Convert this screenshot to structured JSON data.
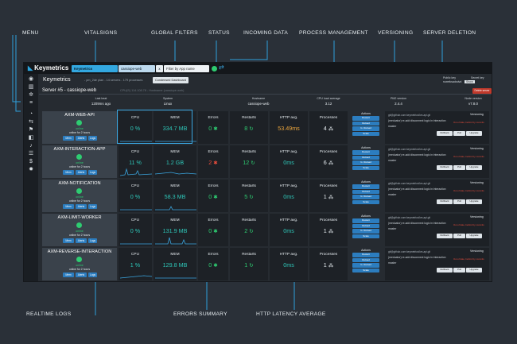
{
  "callouts": {
    "menu": "MENU",
    "vitalsigns": "VITALSIGNS",
    "global_filters": "GLOBAL FILTERS",
    "status": "STATUS",
    "incoming_data": "INCOMING DATA",
    "process_management": "PROCESS MANAGEMENT",
    "versioning": "VERSIONING",
    "server_deletion": "SERVER DELETION",
    "realtime_logs": "REALTIME LOGS",
    "errors_summary": "ERRORS SUMMARY",
    "http_latency": "HTTP LATENCY AVERAGE"
  },
  "topbar": {
    "logo": "Keymetrics",
    "filter_app": "Keymetrics",
    "filter_server": "cassiope-web",
    "filter_clear": "x",
    "filter_placeholder": "Filter by App name"
  },
  "header": {
    "project": "Keymetrics",
    "subtitle": "- pm_2de plan - 14 servers - 179 processes",
    "dashboard_button": "Condensed Dashboard",
    "public_key_label": "Public key",
    "public_key_value": "rowefcsadsdvd",
    "secret_key_label": "Secret key",
    "secret_key_button": "Show"
  },
  "server": {
    "title": "Server #5 - cassiope-web",
    "meta": "CPU(S) 114.108.78 - Hostname (cassiope-web)",
    "delete_label": "Delete server"
  },
  "sysinfo": [
    {
      "label": "Last beat",
      "value": "1209ms ago"
    },
    {
      "label": "System",
      "value": "Linux"
    },
    {
      "label": "Hostname",
      "value": "cassiope-web"
    },
    {
      "label": "CPU load average",
      "value": "3.12"
    },
    {
      "label": "PM2 version",
      "value": "2.4.4"
    },
    {
      "label": "Node version",
      "value": "v7.8.0"
    }
  ],
  "labels": {
    "cpu": "CPU",
    "mem": "MEM",
    "errors": "Errors",
    "restarts": "Restarts",
    "http": "HTTP avg.",
    "processes": "Processes",
    "actions": "Actions",
    "versioning": "Versioning",
    "state": "online",
    "uptime": "online for 2 hours",
    "btn_mem": "Mem",
    "btn_alerts": "Alerts",
    "btn_logs": "Logs",
    "act_restart": "Restart",
    "act_reload": "Reload",
    "act_greload": "G. Reload",
    "act_scale": "Scale",
    "repo": "git@github.com:keymetrics/km-api.git",
    "commit": "(meduator) re-add disconnect logic in interaction",
    "branch": "master",
    "outdated": "Out of date, behind by commits",
    "v_rollback": "Rollback",
    "v_pull": "Pull",
    "v_upgrade": "Upgrade"
  },
  "processes": [
    {
      "name": "AXM-WEB-API",
      "cpu": "0 %",
      "mem": "334.7 MB",
      "errors": "0",
      "restarts": "8",
      "http": "53.49ms",
      "procs": "4",
      "error_color": "#2ecc71",
      "http_color": "#e8a33c"
    },
    {
      "name": "AXM-INTERACTION-APP",
      "cpu": "11 %",
      "mem": "1.2 GB",
      "errors": "2",
      "restarts": "12",
      "http": "0ms",
      "procs": "6",
      "error_color": "#e74c3c",
      "http_color": "#2ec4b6"
    },
    {
      "name": "AXM-NOTIFICATION",
      "cpu": "0 %",
      "mem": "58.3 MB",
      "errors": "0",
      "restarts": "5",
      "http": "0ms",
      "procs": "1",
      "error_color": "#2ecc71",
      "http_color": "#2ec4b6"
    },
    {
      "name": "AXM-LIMIT-WORKER",
      "cpu": "0 %",
      "mem": "131.9 MB",
      "errors": "0",
      "restarts": "2",
      "http": "0ms",
      "procs": "1",
      "error_color": "#2ecc71",
      "http_color": "#2ec4b6"
    },
    {
      "name": "AXM-REVERSE-INTERACTION",
      "cpu": "1 %",
      "mem": "129.8 MB",
      "errors": "0",
      "restarts": "1",
      "http": "0ms",
      "procs": "1",
      "error_color": "#2ecc71",
      "http_color": "#2ec4b6"
    }
  ],
  "colors": {
    "accent": "#3aa6e0",
    "ok": "#2ecc71",
    "error": "#e74c3c",
    "value": "#2ec4b6"
  }
}
